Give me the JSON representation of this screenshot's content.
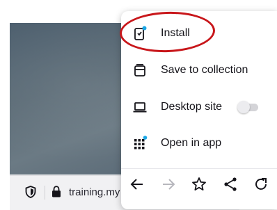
{
  "browser": {
    "url_text": "training.my",
    "menu": {
      "items": [
        {
          "label": "Install",
          "icon": "install-app-icon",
          "has_badge": true
        },
        {
          "label": "Save to collection",
          "icon": "collection-icon"
        },
        {
          "label": "Desktop site",
          "icon": "laptop-icon",
          "toggle_on": false
        },
        {
          "label": "Open in app",
          "icon": "apps-grid-icon",
          "has_badge": true
        }
      ],
      "nav_icons": [
        "back-arrow-icon",
        "forward-arrow-icon",
        "star-icon",
        "share-icon",
        "reload-icon"
      ]
    }
  },
  "annotation": {
    "color": "#c8161a",
    "target": "Install"
  },
  "colors": {
    "badge": "#1aa7e6",
    "icon": "#15141a",
    "disabled": "#b7b7bd"
  }
}
